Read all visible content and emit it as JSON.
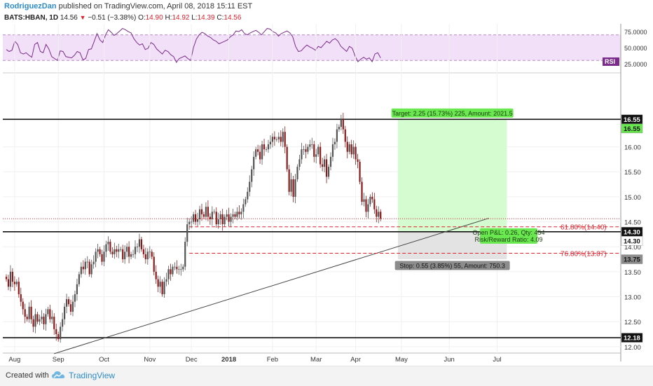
{
  "header": {
    "author": "RodriguezDan",
    "published": "published on TradingView.com, April 08, 2018 15:11 EST",
    "symbol": "BATS:HBAN, 1D",
    "last": "14.56",
    "change": "−0.51 (−3.38%)",
    "o_label": "O:",
    "o": "14.90",
    "h_label": "H:",
    "h": "14.92",
    "l_label": "L:",
    "l": "14.39",
    "c_label": "C:",
    "c": "14.56"
  },
  "footer": {
    "created": "Created with",
    "brand": "TradingView"
  },
  "colors": {
    "up": "#535353",
    "down": "#8b1a1a",
    "red_line": "#e0222c",
    "rsi": "#7b2d8b",
    "rsi_band": "#f1e0f7",
    "target": "#6ae84f",
    "stop": "#8c8c8c",
    "profit_zone": "#d5fbd0",
    "loss_zone": "#e3e3e3"
  },
  "chart_data": [
    {
      "type": "line",
      "title": "RSI",
      "ylabel": "",
      "ylim": [
        15,
        85
      ],
      "yticks": [
        "75.0000",
        "50.0000",
        "25.0000"
      ],
      "ytick_values": [
        75,
        50,
        25
      ],
      "bands": [
        30,
        70
      ],
      "series": [
        {
          "name": "RSI",
          "values": [
            47,
            44,
            46,
            60,
            55,
            42,
            40,
            42,
            38,
            35,
            55,
            58,
            44,
            42,
            55,
            48,
            36,
            33,
            30,
            45,
            44,
            36,
            35,
            34,
            38,
            44,
            42,
            31,
            33,
            47,
            48,
            60,
            72,
            62,
            58,
            70,
            78,
            74,
            69,
            72,
            76,
            80,
            78,
            75,
            73,
            64,
            58,
            54,
            56,
            47,
            49,
            58,
            55,
            48,
            44,
            40,
            46,
            44,
            39,
            36,
            27,
            33,
            35,
            37,
            33,
            30,
            50,
            63,
            70,
            74,
            72,
            68,
            66,
            62,
            60,
            56,
            58,
            60,
            62,
            67,
            70,
            76,
            75,
            78,
            72,
            70,
            73,
            75,
            77,
            74,
            70,
            75,
            80,
            79,
            75,
            73,
            68,
            72,
            74,
            76,
            73,
            67,
            52,
            44,
            45,
            50,
            54,
            51,
            49,
            46,
            52,
            50,
            55,
            60,
            57,
            62,
            64,
            60,
            52,
            48,
            44,
            52,
            49,
            37,
            28,
            32,
            35,
            32,
            34,
            28,
            40,
            42,
            34
          ]
        }
      ]
    },
    {
      "type": "candlestick",
      "title": "",
      "xlabel": "",
      "ylabel": "",
      "ylim": [
        11.9,
        17.2
      ],
      "yticks": [
        "16.00",
        "15.50",
        "15.00",
        "14.50",
        "14.00",
        "13.50",
        "13.00",
        "12.50",
        "12.00"
      ],
      "ytick_values": [
        16,
        15.5,
        15,
        14.5,
        14,
        13.5,
        13,
        12.5,
        12
      ],
      "xticks": [
        "Aug",
        "Sep",
        "Oct",
        "Nov",
        "Dec",
        "2018",
        "Feb",
        "Mar",
        "Apr",
        "May",
        "Jun",
        "Jul"
      ],
      "xtick_bar_index": [
        4,
        25,
        47,
        69,
        89,
        107,
        128,
        149,
        168,
        190,
        213,
        236
      ],
      "closes": [
        13.35,
        13.2,
        13.5,
        13.3,
        13.25,
        13.3,
        13.05,
        12.9,
        12.75,
        12.6,
        12.55,
        12.8,
        12.55,
        12.4,
        12.65,
        12.5,
        12.55,
        12.6,
        12.45,
        12.65,
        12.75,
        12.55,
        12.6,
        12.35,
        12.25,
        12.15,
        12.4,
        12.55,
        12.8,
        12.95,
        12.85,
        12.7,
        12.9,
        13.05,
        13.25,
        13.45,
        13.6,
        13.55,
        13.7,
        13.7,
        13.45,
        13.65,
        13.7,
        13.9,
        13.95,
        13.85,
        13.7,
        13.9,
        14.05,
        14.1,
        13.9,
        13.85,
        13.95,
        13.9,
        13.95,
        13.95,
        13.75,
        13.9,
        14.0,
        13.8,
        13.85,
        13.85,
        14.0,
        14.0,
        14.15,
        13.95,
        13.85,
        13.75,
        13.9,
        13.9,
        13.8,
        13.5,
        13.35,
        13.2,
        13.3,
        13.05,
        13.3,
        13.35,
        13.55,
        13.45,
        13.6,
        13.6,
        13.55,
        13.55,
        13.55,
        13.6,
        14.1,
        14.45,
        14.5,
        14.5,
        14.65,
        14.5,
        14.55,
        14.75,
        14.65,
        14.6,
        14.8,
        14.6,
        14.55,
        14.7,
        14.7,
        14.45,
        14.55,
        14.65,
        14.45,
        14.6,
        14.65,
        14.5,
        14.6,
        14.65,
        14.6,
        14.7,
        14.65,
        14.7,
        14.85,
        14.95,
        15.1,
        15.3,
        15.55,
        15.8,
        15.95,
        15.9,
        15.75,
        16.05,
        15.95,
        15.95,
        16.05,
        16.1,
        16.2,
        16.15,
        16.15,
        16.2,
        16.1,
        16.3,
        16.0,
        15.55,
        15.1,
        15.35,
        15.0,
        15.35,
        15.6,
        15.75,
        15.95,
        15.95,
        15.9,
        16.0,
        16.05,
        16.05,
        15.8,
        15.85,
        16.0,
        15.65,
        15.6,
        15.75,
        15.4,
        15.6,
        15.8,
        16.05,
        16.1,
        16.35,
        16.4,
        16.55,
        16.35,
        16.1,
        15.9,
        16.05,
        15.85,
        16.0,
        15.75,
        15.7,
        15.3,
        14.9,
        14.95,
        14.7,
        14.85,
        15.0,
        14.95,
        14.75,
        14.6,
        14.7,
        14.56
      ],
      "annotations": {
        "target_label": "Target: 2.25 (15.73%) 225, Amount: 2021.5",
        "stop_label": "Stop: 0.55 (3.85%) 55, Amount: 750.3",
        "pnl_line1": "Open P&L: 0.26, Qty: 454",
        "pnl_line2": "Risk/Reward Ratio: 4.09",
        "fib_618": "61.80%(14.40)",
        "fib_786": "76.80%(13.87)",
        "entry": 14.3,
        "target": 16.55,
        "stop": 13.75,
        "fib_618_value": 14.4,
        "fib_786_value": 13.87,
        "support_levels": [
          16.55,
          14.3,
          12.18
        ],
        "trendline_start": {
          "bar": 23,
          "value": 11.86
        },
        "trendline_end": {
          "bar": 232,
          "value": 14.57
        },
        "last_price": 14.56,
        "price_tags": [
          "16.55",
          "16.55",
          "14.30",
          "14.30",
          "13.75",
          "12.18"
        ]
      }
    }
  ]
}
